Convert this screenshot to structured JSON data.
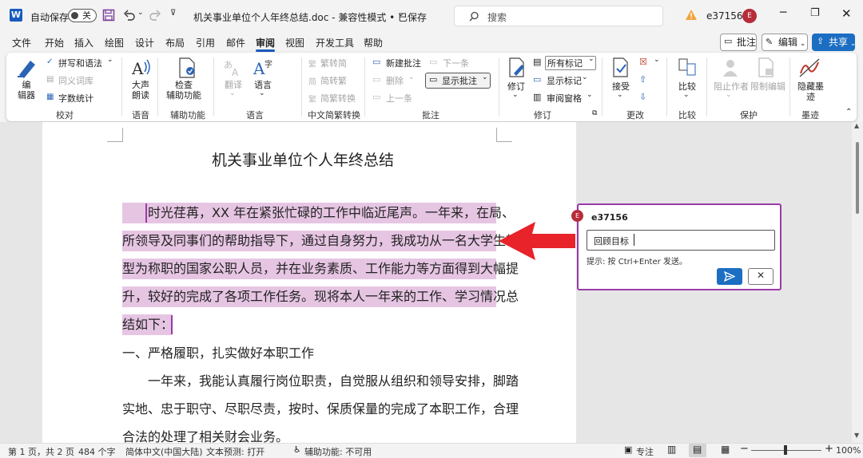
{
  "titlebar": {
    "autosave_label": "自动保存",
    "autosave_state": "关",
    "doc_title": "机关事业单位个人年终总结.doc  -  兼容性模式 • 已保存",
    "search_placeholder": "搜索",
    "user_name": "e37156",
    "avatar_letter": "E"
  },
  "menu": [
    "文件",
    "开始",
    "插入",
    "绘图",
    "设计",
    "布局",
    "引用",
    "邮件",
    "审阅",
    "视图",
    "开发工具",
    "帮助"
  ],
  "menu_right": {
    "comments": "批注",
    "edit": "编辑",
    "share": "共享"
  },
  "ribbon": {
    "proofing": {
      "editor": "编\n辑器",
      "spelling": "拼写和语法",
      "thesaurus": "同义词库",
      "wordcount": "字数统计",
      "group": "校对"
    },
    "speech": {
      "read_aloud": "大声\n朗读",
      "group": "语音"
    },
    "accessibility": {
      "check": "检查\n辅助功能",
      "group": "辅助功能"
    },
    "language": {
      "translate": "翻译",
      "language": "语言",
      "group": "语言"
    },
    "chinese": {
      "to_trad": "繁转简",
      "to_simp": "简转繁",
      "convert": "简繁转换",
      "group": "中文简繁转换"
    },
    "comments": {
      "new": "新建批注",
      "delete": "删除",
      "previous": "上一条",
      "next": "下一条",
      "show": "显示批注",
      "group": "批注"
    },
    "tracking": {
      "track": "修订",
      "all_markup": "所有标记",
      "show_markup": "显示标记",
      "review_pane": "审阅窗格",
      "group": "修订"
    },
    "changes": {
      "accept": "接受",
      "group": "更改"
    },
    "compare": {
      "compare": "比较",
      "group": "比较"
    },
    "protect": {
      "block": "阻止作者",
      "restrict": "限制编辑",
      "group": "保护"
    },
    "ink": {
      "hide": "隐藏墨\n迹",
      "group": "墨迹"
    }
  },
  "document": {
    "title": "机关事业单位个人年终总结",
    "highlighted_lines": [
      "时光荏苒，XX 年在紧张忙碌的工作中临近尾声。一年来，在局、",
      "所领导及同事们的帮助指导下，通过自身努力，我成功从一名大学生转",
      "型为称职的国家公职人员，并在业务素质、工作能力等方面得到大幅提",
      "升，较好的完成了各项工作任务。现将本人一年来的工作、学习情况总",
      "结如下："
    ],
    "heading1": "一、严格履职，扎实做好本职工作",
    "body_lines": [
      "一年来，我能认真履行岗位职责，自觉服从组织和领导安排，脚踏",
      "实地、忠于职守、尽职尽责，按时、保质保量的完成了本职工作，合理",
      "合法的处理了相关财会业务。"
    ]
  },
  "comment": {
    "author": "e37156",
    "text": "回顾目标",
    "hint": "提示: 按 Ctrl+Enter 发送。"
  },
  "status": {
    "page": "第 1 页，共 2 页",
    "words": "484 个字",
    "language": "简体中文(中国大陆)",
    "prediction": "文本预测: 打开",
    "accessibility": "辅助功能: 不可用",
    "focus": "专注",
    "zoom": "100%"
  },
  "colors": {
    "accent": "#1b6ec2",
    "comment_border": "#9a3aa8",
    "highlight": "#e6c5e3",
    "arrow": "#e8232a"
  }
}
